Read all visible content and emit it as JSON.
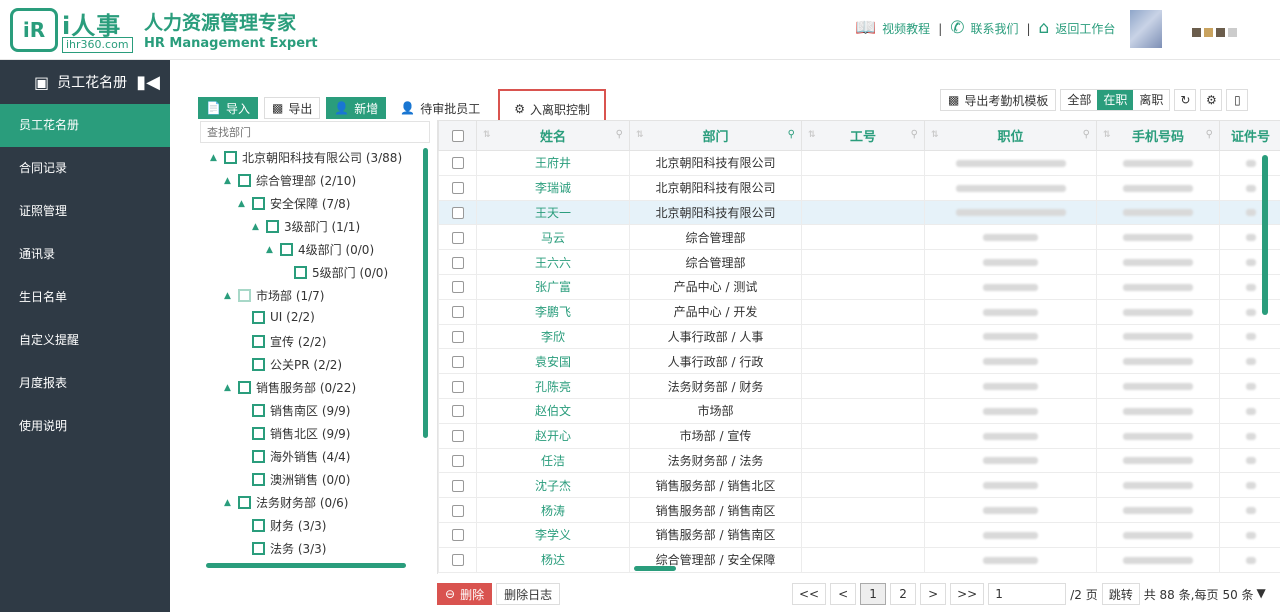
{
  "header": {
    "logo_mark": "iR",
    "logo_name": "i人事",
    "logo_url": "ihr360.com",
    "brand_cn": "人力资源管理专家",
    "brand_en": "HR Management Expert",
    "links": [
      {
        "label": "视频教程",
        "icon": "book-icon"
      },
      {
        "label": "联系我们",
        "icon": "phone-icon"
      },
      {
        "label": "返回工作台",
        "icon": "home-icon"
      }
    ]
  },
  "sidebar": {
    "title": "员工花名册",
    "items": [
      "员工花名册",
      "合同记录",
      "证照管理",
      "通讯录",
      "生日名单",
      "自定义提醒",
      "月度报表",
      "使用说明"
    ]
  },
  "toolbar": {
    "import": "导入",
    "export": "导出",
    "add": "新增",
    "pending": "待审批员工",
    "onboard_control": "入离职控制",
    "export_template": "导出考勤机模板",
    "filter_all": "全部",
    "filter_active": "在职",
    "filter_left": "离职"
  },
  "tree": {
    "search_placeholder": "查找部门",
    "nodes": [
      {
        "label": "北京朝阳科技有限公司 (3/88)"
      },
      {
        "label": "综合管理部 (2/10)"
      },
      {
        "label": "安全保障 (7/8)"
      },
      {
        "label": "3级部门 (1/1)"
      },
      {
        "label": "4级部门 (0/0)"
      },
      {
        "label": "5级部门 (0/0)"
      },
      {
        "label": "市场部 (1/7)"
      },
      {
        "label": "UI (2/2)"
      },
      {
        "label": "宣传 (2/2)"
      },
      {
        "label": "公关PR (2/2)"
      },
      {
        "label": "销售服务部 (0/22)"
      },
      {
        "label": "销售南区 (9/9)"
      },
      {
        "label": "销售北区 (9/9)"
      },
      {
        "label": "海外销售 (4/4)"
      },
      {
        "label": "澳洲销售 (0/0)"
      },
      {
        "label": "法务财务部 (0/6)"
      },
      {
        "label": "财务 (3/3)"
      },
      {
        "label": "法务 (3/3)"
      }
    ]
  },
  "table": {
    "columns": [
      "姓名",
      "部门",
      "工号",
      "职位",
      "手机号码",
      "证件号"
    ],
    "rows": [
      {
        "name": "王府井",
        "dept": "北京朝阳科技有限公司"
      },
      {
        "name": "李瑞诚",
        "dept": "北京朝阳科技有限公司"
      },
      {
        "name": "王天一",
        "dept": "北京朝阳科技有限公司"
      },
      {
        "name": "马云",
        "dept": "综合管理部"
      },
      {
        "name": "王六六",
        "dept": "综合管理部"
      },
      {
        "name": "张广富",
        "dept": "产品中心 / 测试"
      },
      {
        "name": "李鹏飞",
        "dept": "产品中心 / 开发"
      },
      {
        "name": "李欣",
        "dept": "人事行政部 / 人事"
      },
      {
        "name": "袁安国",
        "dept": "人事行政部 / 行政"
      },
      {
        "name": "孔陈亮",
        "dept": "法务财务部 / 财务"
      },
      {
        "name": "赵伯文",
        "dept": "市场部"
      },
      {
        "name": "赵开心",
        "dept": "市场部 / 宣传"
      },
      {
        "name": "任洁",
        "dept": "法务财务部 / 法务"
      },
      {
        "name": "沈子杰",
        "dept": "销售服务部 / 销售北区"
      },
      {
        "name": "杨涛",
        "dept": "销售服务部 / 销售南区"
      },
      {
        "name": "李学义",
        "dept": "销售服务部 / 销售南区"
      },
      {
        "name": "杨达",
        "dept": "综合管理部 / 安全保障"
      }
    ]
  },
  "footer": {
    "delete": "删除",
    "delete_log": "删除日志",
    "first": "<<",
    "prev": "<",
    "pages": [
      "1",
      "2"
    ],
    "next": ">",
    "last": ">>",
    "page_input": "1",
    "total_pages": "/2 页",
    "jump": "跳转",
    "summary": "共 88 条,每页",
    "per_page": "50 条"
  },
  "colors": {
    "accent": "#2a9d7c",
    "sidebar": "#2f3a45",
    "highlight": "#d9534f"
  }
}
